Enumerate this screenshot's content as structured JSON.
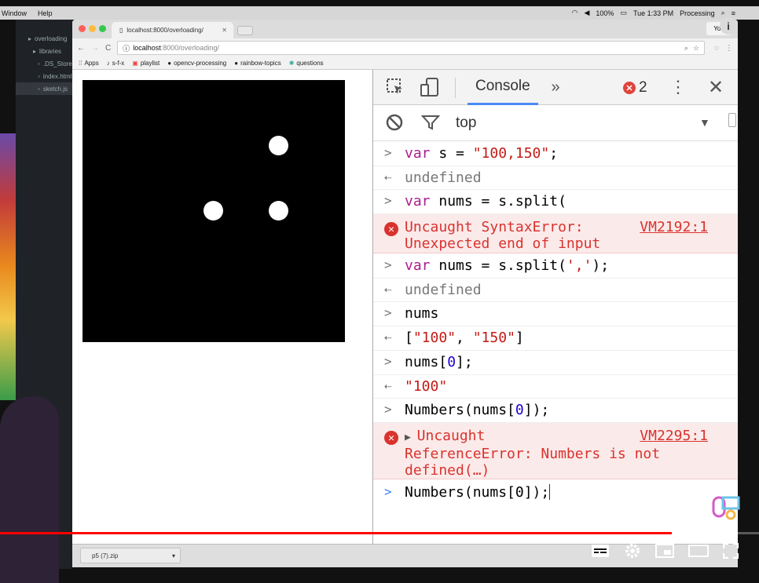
{
  "menubar": {
    "left_items": [
      "Window",
      "Help"
    ],
    "battery": "100%",
    "clock": "Tue 1:33 PM",
    "app_name": "Processing"
  },
  "editor": {
    "files": [
      "overloading",
      "libraries",
      ".DS_Store",
      "index.html",
      "sketch.js"
    ]
  },
  "browser": {
    "tab_title": "localhost:8000/overloading/",
    "user_button": "You",
    "url_host": "localhost",
    "url_path": ":8000/overloading/",
    "bookmarks": [
      "Apps",
      "s-f-x",
      "playlist",
      "opencv-processing",
      "rainbow-topics",
      "questions"
    ]
  },
  "sketch": {
    "background": "#000000",
    "dot_color": "#ffffff"
  },
  "devtools": {
    "tab_console": "Console",
    "error_count": "2",
    "context": "top",
    "log": {
      "l1_kw": "var",
      "l1_rest": " s = ",
      "l1_str": "\"100,150\"",
      "l1_end": ";",
      "l2": "undefined",
      "l3_kw": "var",
      "l3_rest": " nums = s.split(",
      "l4_msg1": "Uncaught SyntaxError:",
      "l4_msg2": "Unexpected end of input",
      "l4_src": "VM2192:1",
      "l5_kw": "var",
      "l5_rest": " nums = s.split(",
      "l5_str": "','",
      "l5_end": ");",
      "l6": "undefined",
      "l7": "nums",
      "l8_open": "[",
      "l8_s1": "\"100\"",
      "l8_sep": ", ",
      "l8_s2": "\"150\"",
      "l8_close": "]",
      "l9_a": "nums[",
      "l9_n": "0",
      "l9_b": "];",
      "l10": "\"100\"",
      "l11_a": "Numbers(nums[",
      "l11_n": "0",
      "l11_b": "]);",
      "l12_msg1": "Uncaught",
      "l12_msg2": "ReferenceError: Numbers is not",
      "l12_msg3": "defined(…)",
      "l12_src": "VM2295:1",
      "l13": "Numbers(nums[0]);"
    }
  },
  "downloads": {
    "item": "p5 (7).zip"
  },
  "video": {
    "progress_fraction": 0.885,
    "progress_color": "#ff0000"
  }
}
